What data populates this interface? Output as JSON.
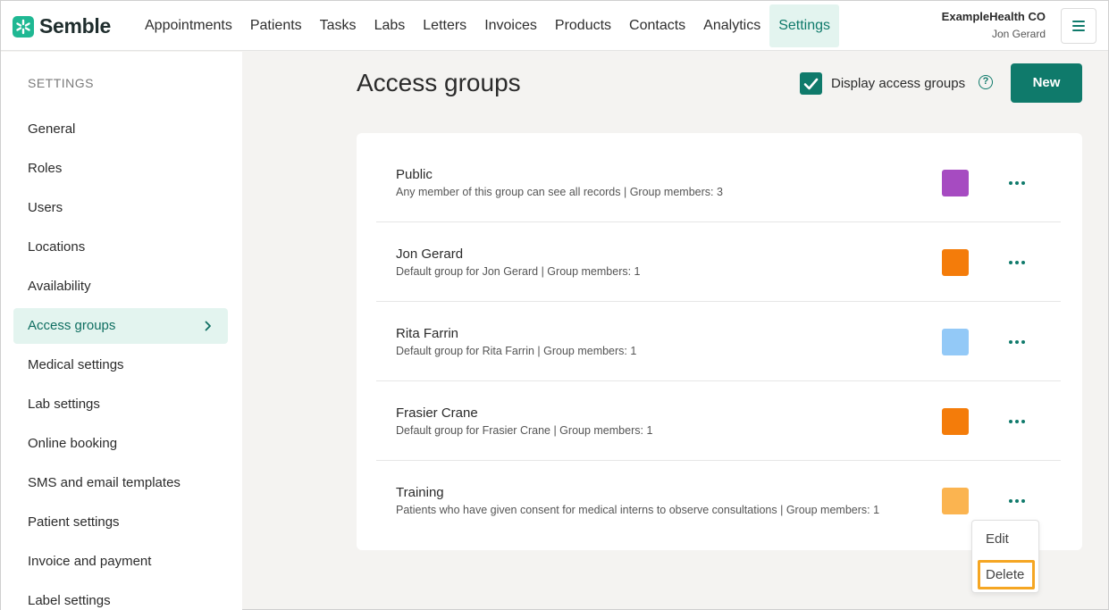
{
  "app": {
    "brand": "Semble",
    "accent": "#0f7a6b",
    "brand_color": "#1fb893"
  },
  "nav": {
    "items": [
      {
        "label": "Appointments",
        "name": "nav-appointments"
      },
      {
        "label": "Patients",
        "name": "nav-patients"
      },
      {
        "label": "Tasks",
        "name": "nav-tasks"
      },
      {
        "label": "Labs",
        "name": "nav-labs"
      },
      {
        "label": "Letters",
        "name": "nav-letters"
      },
      {
        "label": "Invoices",
        "name": "nav-invoices"
      },
      {
        "label": "Products",
        "name": "nav-products"
      },
      {
        "label": "Contacts",
        "name": "nav-contacts"
      },
      {
        "label": "Analytics",
        "name": "nav-analytics"
      },
      {
        "label": "Settings",
        "name": "nav-settings",
        "active": true
      }
    ]
  },
  "account": {
    "org": "ExampleHealth CO",
    "user": "Jon Gerard"
  },
  "sidebar": {
    "heading": "SETTINGS",
    "items": [
      {
        "label": "General"
      },
      {
        "label": "Roles"
      },
      {
        "label": "Users"
      },
      {
        "label": "Locations"
      },
      {
        "label": "Availability"
      },
      {
        "label": "Access groups",
        "active": true
      },
      {
        "label": "Medical settings"
      },
      {
        "label": "Lab settings"
      },
      {
        "label": "Online booking"
      },
      {
        "label": "SMS and email templates"
      },
      {
        "label": "Patient settings"
      },
      {
        "label": "Invoice and payment"
      },
      {
        "label": "Label settings"
      }
    ]
  },
  "main": {
    "title": "Access groups",
    "display_toggle": {
      "label": "Display access groups",
      "checked": true
    },
    "help_icon": "?",
    "new_button": "New",
    "groups": [
      {
        "name": "Public",
        "description": "Any member of this group can see all records | Group members: 3",
        "color": "#a64bc1"
      },
      {
        "name": "Jon Gerard",
        "description": "Default group for Jon Gerard | Group members: 1",
        "color": "#f47c0a"
      },
      {
        "name": "Rita Farrin",
        "description": "Default group for Rita Farrin | Group members: 1",
        "color": "#93c9f7"
      },
      {
        "name": "Frasier Crane",
        "description": "Default group for Frasier Crane | Group members: 1",
        "color": "#f47c0a"
      },
      {
        "name": "Training",
        "description": "Patients who have given consent for medical interns to observe consultations | Group members: 1",
        "color": "#fbb450"
      }
    ],
    "row_menu": {
      "edit": "Edit",
      "delete": "Delete",
      "highlight_color": "#f5a623"
    }
  }
}
